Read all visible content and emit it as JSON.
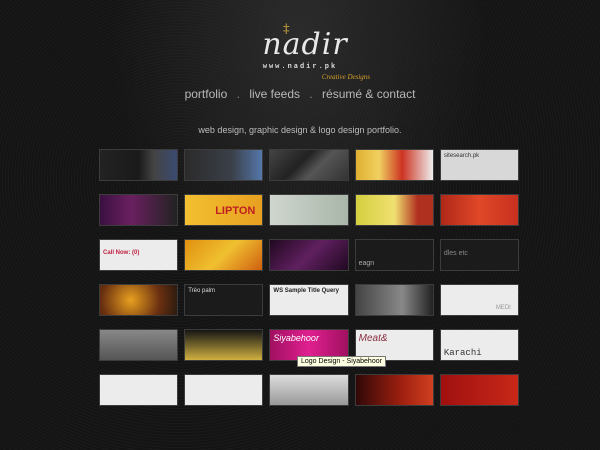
{
  "logo": {
    "mark": "‡",
    "name": "nadir",
    "url": "www.nadir.pk",
    "tagline": "Creative Designs"
  },
  "nav": {
    "items": [
      "portfolio",
      "live feeds",
      "résumé & contact"
    ],
    "separator": "."
  },
  "tagline": "web design, graphic design & logo design portfolio.",
  "thumbnails": {
    "row1": [
      "",
      "",
      "",
      "",
      "sitesearch.pk"
    ],
    "row2": [
      "",
      "LIPTON",
      "",
      "",
      ""
    ],
    "row3": [
      "Call Now: (0)",
      "",
      "",
      "eagn",
      "dles etc"
    ],
    "row4": [
      "",
      "Trèo palm",
      "WS Sample Title Query",
      "",
      "MEDI"
    ],
    "row5": [
      "",
      "",
      "Siyabehoor",
      "Meat&",
      "Karachi"
    ],
    "row6": [
      "",
      "",
      "",
      "",
      ""
    ]
  },
  "tooltip": "Logo Design - Siyabehoor",
  "colors": {
    "background": "#161616",
    "text": "#b9b9b9",
    "accent": "#d9a030"
  }
}
